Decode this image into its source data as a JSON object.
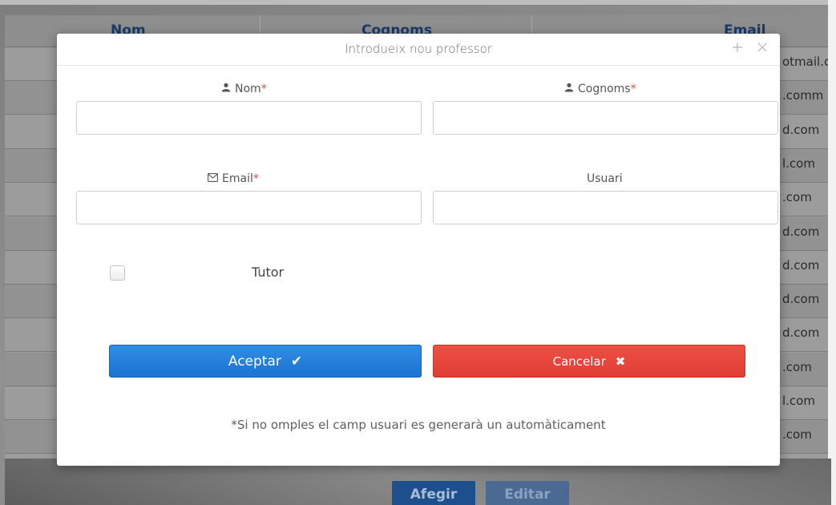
{
  "background": {
    "table_headers": [
      "Nom",
      "Cognoms",
      "Email"
    ],
    "email_fragments": [
      "otmail.co",
      ".comm",
      "d.com",
      "l.com",
      ".com",
      "d.com",
      "d.com",
      "d.com",
      "d.com",
      ".com",
      "l.com",
      ".com"
    ],
    "buttons": {
      "add_label": "Afegir",
      "edit_label": "Editar"
    }
  },
  "modal": {
    "title": "Introdueix nou professor",
    "icons": {
      "expand": "plus-icon",
      "close": "close-icon"
    },
    "fields": {
      "nom": {
        "label": "Nom",
        "required_mark": "*",
        "icon": "user-icon",
        "value": "",
        "placeholder": ""
      },
      "cognoms": {
        "label": "Cognoms",
        "required_mark": "*",
        "icon": "user-icon",
        "value": "",
        "placeholder": ""
      },
      "email": {
        "label": "Email",
        "required_mark": "*",
        "icon": "envelope-icon",
        "value": "",
        "placeholder": ""
      },
      "usuari": {
        "label": "Usuari",
        "value": "",
        "placeholder": ""
      }
    },
    "tutor": {
      "label": "Tutor",
      "checked": false
    },
    "buttons": {
      "ok": {
        "label": "Aceptar",
        "icon": "check-icon",
        "glyph": "✔",
        "color": "#2380dc"
      },
      "cancel": {
        "label": "Cancelar",
        "icon": "times-icon",
        "glyph": "✖",
        "color": "#e6483e"
      }
    },
    "note": "*Si no omples el camp usuari es generarà un automàticament"
  }
}
